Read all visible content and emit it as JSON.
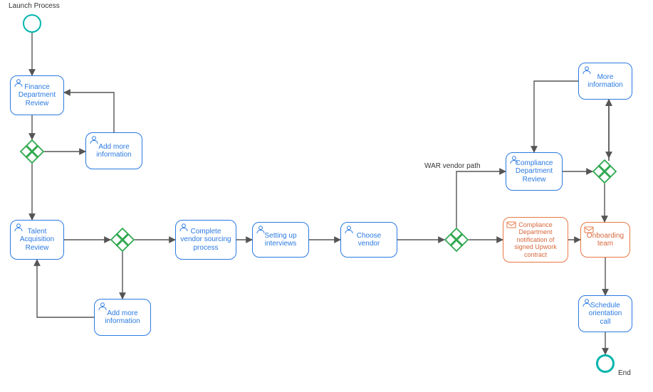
{
  "labels": {
    "start": "Launch Process",
    "end": "End",
    "war_path": "WAR vendor path"
  },
  "tasks": {
    "finance_review": "Finance Department Review",
    "add_info_1": "Add more information",
    "talent_review": "Talent Acquisition Review",
    "add_info_2": "Add more information",
    "vendor_sourcing": "Complete vendor sourcing process",
    "interviews": "Setting up interviews",
    "choose_vendor": "Choose vendor",
    "compliance_review": "Compliance Department Review",
    "more_info": "More information",
    "compliance_notify": "Compliance Department notification of signed Upwork contract",
    "onboarding": "Onboarding team",
    "orientation": "Schedule orientation call"
  },
  "chart_data": {
    "type": "bpmn-flow",
    "start": {
      "id": "start",
      "label": "Launch Process"
    },
    "end": {
      "id": "end",
      "label": "End"
    },
    "tasks": [
      {
        "id": "finance_review",
        "type": "user",
        "label": "Finance Department Review"
      },
      {
        "id": "add_info_1",
        "type": "user",
        "label": "Add more information"
      },
      {
        "id": "talent_review",
        "type": "user",
        "label": "Talent Acquisition Review"
      },
      {
        "id": "add_info_2",
        "type": "user",
        "label": "Add more information"
      },
      {
        "id": "vendor_sourcing",
        "type": "user",
        "label": "Complete vendor sourcing process"
      },
      {
        "id": "interviews",
        "type": "user",
        "label": "Setting up interviews"
      },
      {
        "id": "choose_vendor",
        "type": "user",
        "label": "Choose vendor"
      },
      {
        "id": "compliance_review",
        "type": "user",
        "label": "Compliance Department Review"
      },
      {
        "id": "more_info",
        "type": "user",
        "label": "More information"
      },
      {
        "id": "compliance_notify",
        "type": "message",
        "label": "Compliance Department notification of signed Upwork contract"
      },
      {
        "id": "onboarding",
        "type": "message",
        "label": "Onboarding team"
      },
      {
        "id": "orientation",
        "type": "user",
        "label": "Schedule orientation call"
      }
    ],
    "gateways": [
      {
        "id": "gw1",
        "type": "exclusive"
      },
      {
        "id": "gw2",
        "type": "exclusive"
      },
      {
        "id": "gw3",
        "type": "exclusive"
      },
      {
        "id": "gw4",
        "type": "exclusive"
      }
    ],
    "flows": [
      {
        "from": "start",
        "to": "finance_review"
      },
      {
        "from": "finance_review",
        "to": "gw1"
      },
      {
        "from": "gw1",
        "to": "add_info_1"
      },
      {
        "from": "add_info_1",
        "to": "finance_review"
      },
      {
        "from": "gw1",
        "to": "talent_review"
      },
      {
        "from": "talent_review",
        "to": "gw2"
      },
      {
        "from": "gw2",
        "to": "add_info_2"
      },
      {
        "from": "add_info_2",
        "to": "talent_review"
      },
      {
        "from": "gw2",
        "to": "vendor_sourcing"
      },
      {
        "from": "vendor_sourcing",
        "to": "interviews"
      },
      {
        "from": "interviews",
        "to": "choose_vendor"
      },
      {
        "from": "choose_vendor",
        "to": "gw3"
      },
      {
        "from": "gw3",
        "to": "compliance_review",
        "label": "WAR vendor path"
      },
      {
        "from": "compliance_review",
        "to": "gw4"
      },
      {
        "from": "gw4",
        "to": "more_info"
      },
      {
        "from": "more_info",
        "to": "compliance_review"
      },
      {
        "from": "gw3",
        "to": "compliance_notify"
      },
      {
        "from": "compliance_notify",
        "to": "onboarding"
      },
      {
        "from": "gw4",
        "to": "onboarding"
      },
      {
        "from": "onboarding",
        "to": "orientation"
      },
      {
        "from": "orientation",
        "to": "end"
      }
    ]
  }
}
